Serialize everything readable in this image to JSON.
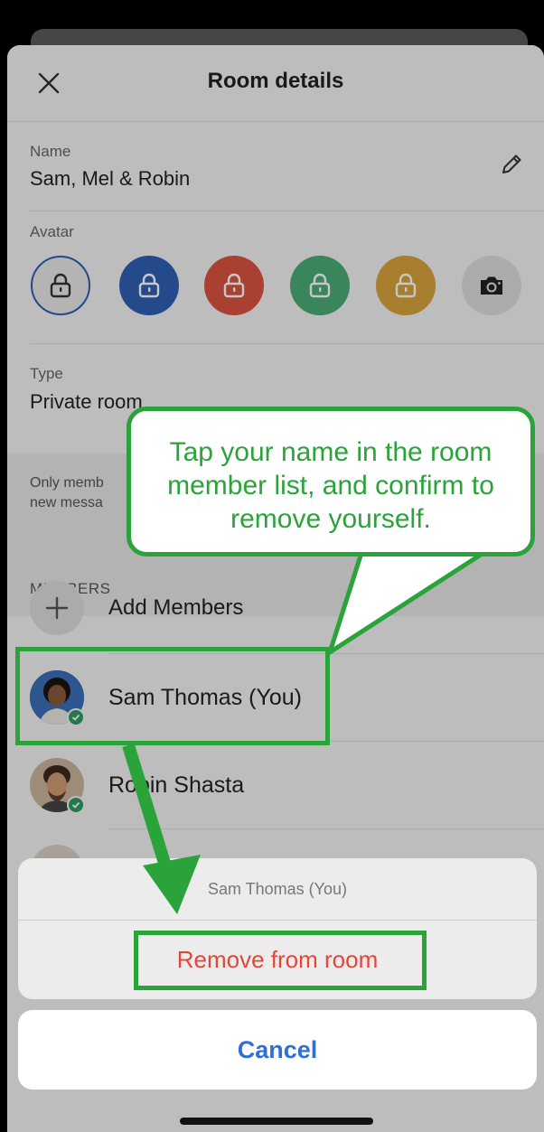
{
  "header": {
    "title": "Room details"
  },
  "name_field": {
    "label": "Name",
    "value": "Sam, Mel & Robin"
  },
  "avatar_field": {
    "label": "Avatar",
    "options": [
      {
        "name": "lock-grey",
        "color": "#e7e7e7",
        "selected": true
      },
      {
        "name": "lock-blue",
        "color": "#2f5fb3",
        "selected": false
      },
      {
        "name": "lock-red",
        "color": "#d9533f",
        "selected": false
      },
      {
        "name": "lock-green",
        "color": "#4bab77",
        "selected": false
      },
      {
        "name": "lock-yellow",
        "color": "#d6a23a",
        "selected": false
      },
      {
        "name": "camera",
        "color": "#dcdcdc",
        "selected": false
      }
    ]
  },
  "type_field": {
    "label": "Type",
    "value": "Private room"
  },
  "info": {
    "line1": "Only memb",
    "line2": "new messa"
  },
  "members": {
    "section_title": "MEMBERS",
    "add_label": "Add Members",
    "list": [
      {
        "name": "Sam Thomas (You)"
      },
      {
        "name": "Robin Shasta"
      }
    ]
  },
  "action_sheet": {
    "title": "Sam Thomas (You)",
    "remove_label": "Remove from room",
    "cancel_label": "Cancel"
  },
  "callout": {
    "text": "Tap your name in the room member list, and confirm to remove yourself."
  },
  "colors": {
    "accent_green": "#2aa33a",
    "destructive_red": "#e0483a",
    "link_blue": "#2f6fd6"
  }
}
